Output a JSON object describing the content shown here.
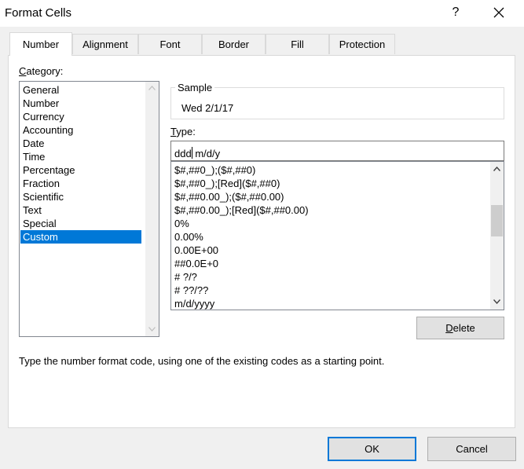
{
  "window": {
    "title": "Format Cells",
    "help_label": "?"
  },
  "tabs": [
    {
      "label": "Number",
      "active": true
    },
    {
      "label": "Alignment",
      "active": false
    },
    {
      "label": "Font",
      "active": false
    },
    {
      "label": "Border",
      "active": false
    },
    {
      "label": "Fill",
      "active": false
    },
    {
      "label": "Protection",
      "active": false
    }
  ],
  "category": {
    "label_first": "C",
    "label_rest": "ategory:",
    "items": [
      "General",
      "Number",
      "Currency",
      "Accounting",
      "Date",
      "Time",
      "Percentage",
      "Fraction",
      "Scientific",
      "Text",
      "Special",
      "Custom"
    ],
    "selected": "Custom"
  },
  "sample": {
    "label": "Sample",
    "value": "Wed 2/1/17"
  },
  "type": {
    "label_first": "T",
    "label_rest": "ype:",
    "value_before_caret": "ddd",
    "value_after_caret": " m/d/y",
    "codes": [
      "$#,##0_);($#,##0)",
      "$#,##0_);[Red]($#,##0)",
      "$#,##0.00_);($#,##0.00)",
      "$#,##0.00_);[Red]($#,##0.00)",
      "0%",
      "0.00%",
      "0.00E+00",
      "##0.0E+0",
      "# ?/?",
      "# ??/??",
      "m/d/yyyy"
    ]
  },
  "buttons": {
    "delete_first": "D",
    "delete_rest": "elete",
    "ok": "OK",
    "cancel": "Cancel"
  },
  "hint": "Type the number format code, using one of the existing codes as a starting point.",
  "colors": {
    "selection": "#0078d7",
    "default_border": "#0078d7"
  },
  "icons": {
    "close": "close-icon",
    "scroll_up": "chevron-up-icon",
    "scroll_down": "chevron-down-icon"
  }
}
